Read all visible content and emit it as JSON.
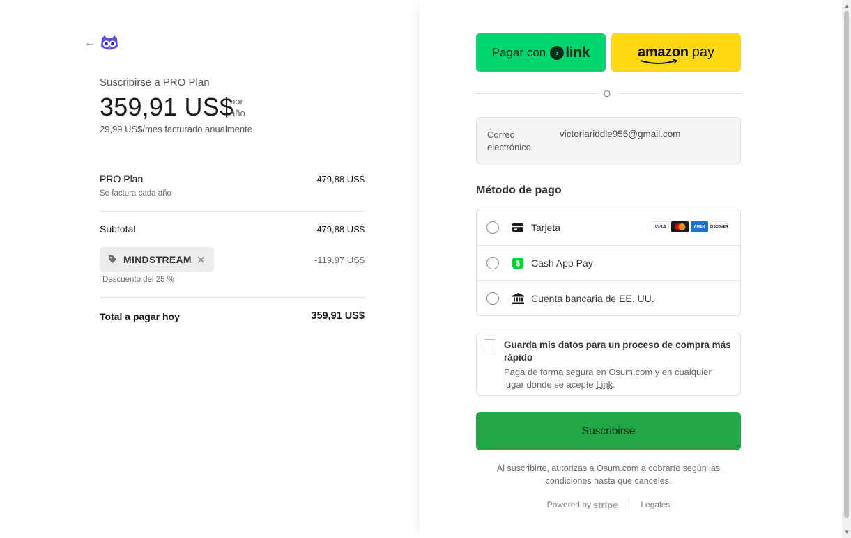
{
  "summary": {
    "back_icon": "arrow-left-icon",
    "logo_icon": "owl-logo-icon",
    "subscribe_to": "Suscribirse a PRO Plan",
    "price": "359,91 US$",
    "per_line1": "por",
    "per_line2": "año",
    "monthly_note": "29,99 US$/mes facturado anualmente",
    "plan_name": "PRO Plan",
    "plan_price": "479,88 US$",
    "plan_billing": "Se factura cada año",
    "subtotal_label": "Subtotal",
    "subtotal_value": "479,88 US$",
    "coupon_code": "MINDSTREAM",
    "coupon_discount": "-119,97 US$",
    "coupon_note": "Descuento del 25 %",
    "total_label": "Total a pagar hoy",
    "total_value": "359,91 US$"
  },
  "express": {
    "link_prefix": "Pagar con",
    "link_arrow": "›",
    "link_brand": "link",
    "amazon_brand": "amazon",
    "amazon_suffix": "pay",
    "separator": "O"
  },
  "email": {
    "label": "Correo electrónico",
    "value": "victoriariddle955@gmail.com"
  },
  "payment": {
    "title": "Método de pago",
    "methods": [
      {
        "label": "Tarjeta",
        "icon": "card-icon"
      },
      {
        "label": "Cash App Pay",
        "icon": "cash-app-icon"
      },
      {
        "label": "Cuenta bancaria de EE. UU.",
        "icon": "bank-icon"
      }
    ],
    "card_brands": [
      "VISA",
      "MC",
      "AMEX",
      "DISCOVER"
    ]
  },
  "save": {
    "title": "Guarda mis datos para un proceso de compra más rápido",
    "desc_prefix": "Paga de forma segura en Osum.com y en cualquier lugar donde se acepte ",
    "desc_link": "Link",
    "desc_suffix": "."
  },
  "actions": {
    "subscribe": "Suscribirse",
    "terms": "Al suscribirte, autorizas a Osum.com a cobrarte según las condiciones hasta que canceles.",
    "powered_by": "Powered by",
    "stripe": "stripe",
    "legal": "Legales"
  },
  "colors": {
    "link_green": "#00d66f",
    "amazon_yellow": "#ffd814",
    "subscribe_green": "#23a647"
  }
}
